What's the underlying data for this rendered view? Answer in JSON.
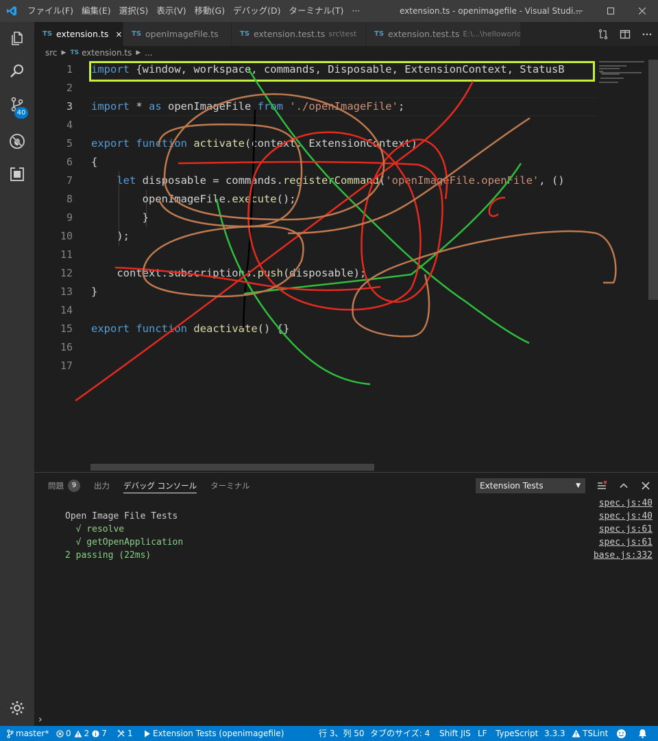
{
  "titlebar": {
    "menu": [
      "ファイル(F)",
      "編集(E)",
      "選択(S)",
      "表示(V)",
      "移動(G)",
      "デバッグ(D)",
      "ターミナル(T)",
      "···"
    ],
    "window_title": "extension.ts - openimagefile - Visual Studi..."
  },
  "activity": {
    "scm_badge": "40"
  },
  "tabs": [
    {
      "icon": "TS",
      "name": "extension.ts",
      "desc": "",
      "close": "×"
    },
    {
      "icon": "TS",
      "name": "openImageFile.ts",
      "desc": "",
      "close": ""
    },
    {
      "icon": "TS",
      "name": "extension.test.ts",
      "desc": "src\\test",
      "close": ""
    },
    {
      "icon": "TS",
      "name": "extension.test.ts",
      "desc": "E:\\...\\helloworld\\...",
      "close": ""
    }
  ],
  "breadcrumb": {
    "folder": "src",
    "icon": "TS",
    "file": "extension.ts",
    "more": "..."
  },
  "editor": {
    "line_numbers": [
      "1",
      "2",
      "3",
      "4",
      "5",
      "6",
      "7",
      "8",
      "9",
      "10",
      "11",
      "12",
      "13",
      "14",
      "15",
      "16",
      "17"
    ],
    "lines": {
      "l1a": "import",
      "l1b": " {window, workspace, commands, Disposable, ExtensionContext, StatusB",
      "l3a": "import",
      "l3b": " * ",
      "l3c": "as",
      "l3d": " openImageFile ",
      "l3e": "from",
      "l3f": " ",
      "l3g": "'./openImageFile'",
      "l3h": ";",
      "l5a": "export",
      "l5b": " ",
      "l5c": "function",
      "l5d": " ",
      "l5e": "activate",
      "l5f": "(context: ExtensionContext)",
      "l6": "{",
      "l7a": "    ",
      "l7b": "let",
      "l7c": " disposable = commands.",
      "l7d": "registerCommand",
      "l7e": "(",
      "l7f": "'openImageFile.openFile'",
      "l7g": ", ()",
      "l8a": "        openImageFile.",
      "l8b": "execute",
      "l8c": "();",
      "l9": "        }",
      "l10": "    );",
      "l12a": "    context.subscriptions.",
      "l12b": "push",
      "l12c": "(disposable);",
      "l13": "}",
      "l15a": "export",
      "l15b": " ",
      "l15c": "function",
      "l15d": " ",
      "l15e": "deactivate",
      "l15f": "() {}"
    }
  },
  "panel": {
    "tabs": [
      {
        "label": "問題",
        "count": "9"
      },
      {
        "label": "出力",
        "count": ""
      },
      {
        "label": "デバッグ コンソール",
        "count": ""
      },
      {
        "label": "ターミナル",
        "count": ""
      }
    ],
    "select_value": "Extension Tests",
    "output": [
      {
        "text": "Open Image File Tests",
        "link": "spec.js:40"
      },
      {
        "text": "  √ resolve",
        "link": "spec.js:40"
      },
      {
        "text": "  √ getOpenApplication",
        "link": "spec.js:61"
      },
      {
        "text": "",
        "link": "spec.js:61"
      },
      {
        "text": "2 passing (22ms)",
        "link": "base.js:332"
      }
    ],
    "prompt": "›"
  },
  "statusbar": {
    "branch": "master*",
    "errors": "0",
    "warnings": "2",
    "infos": "7",
    "tools": "1",
    "debug": "Extension Tests (openimagefile)",
    "position": "行 3、列 50",
    "tabsize": "タブのサイズ: 4",
    "encoding": "Shift JIS",
    "eol": "LF",
    "language": "TypeScript",
    "version": "3.3.3",
    "linter": "TSLint"
  },
  "colors": {
    "accent": "#007acc",
    "highlight_box": "#c6f03a"
  }
}
